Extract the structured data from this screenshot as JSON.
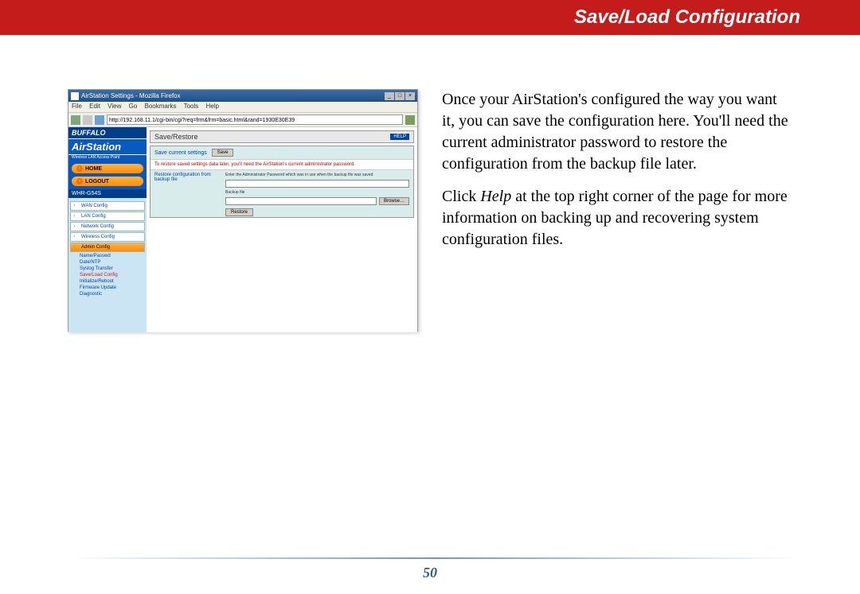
{
  "header": {
    "title": "Save/Load Configuration"
  },
  "screenshot": {
    "window_title": "AirStation Settings - Mozilla Firefox",
    "menus": [
      "File",
      "Edit",
      "View",
      "Go",
      "Bookmarks",
      "Tools",
      "Help"
    ],
    "url": "http://192.168.11.1/cgi-bin/cgi?req=frm&frm=basic.html&rand=1930E30E39",
    "logo": "BUFFALO",
    "product": "AirStation",
    "product_sub": "Wireless LAN Access Point",
    "nav_home": "HOME",
    "nav_logout": "LOGOUT",
    "model": "WHR-G54S",
    "side_items": [
      {
        "label": "WAN Config",
        "active": false
      },
      {
        "label": "LAN Config",
        "active": false
      },
      {
        "label": "Network Config",
        "active": false
      },
      {
        "label": "Wireless Config",
        "active": false
      },
      {
        "label": "Admin Config",
        "active": true
      }
    ],
    "sub_items": [
      {
        "label": "Name/Passwd",
        "red": false
      },
      {
        "label": "Date/NTP",
        "red": false
      },
      {
        "label": "Syslog Transfer",
        "red": false
      },
      {
        "label": "Save/Load Config",
        "red": true
      },
      {
        "label": "Initialize/Reboot",
        "red": false
      },
      {
        "label": "Firmware Update",
        "red": false
      },
      {
        "label": "Diagnostic",
        "red": false
      }
    ],
    "panel_title": "Save/Restore",
    "help_label": "HELP",
    "row1_label": "Save current settings",
    "row1_btn": "Save",
    "red_note": "To restore saved settings data later, you'll need the AirStation's current administrator password.",
    "row2_label": "Restore configuration from backup file",
    "row2_note": "Enter the Administrator Password which was in use when the backup file was saved",
    "backup_label": "Backup file",
    "browse": "Browse…",
    "restore": "Restore"
  },
  "body": {
    "p1_a": "Once your AirStation's configured the way you want it, you can save the configuration here.  You'll need the current administrator password to restore the configuration from the backup file later.",
    "p2_a": "Click ",
    "p2_em": "Help",
    "p2_b": " at the top right corner of the page for more information on backing up and recovering system configuration files."
  },
  "page_number": "50"
}
